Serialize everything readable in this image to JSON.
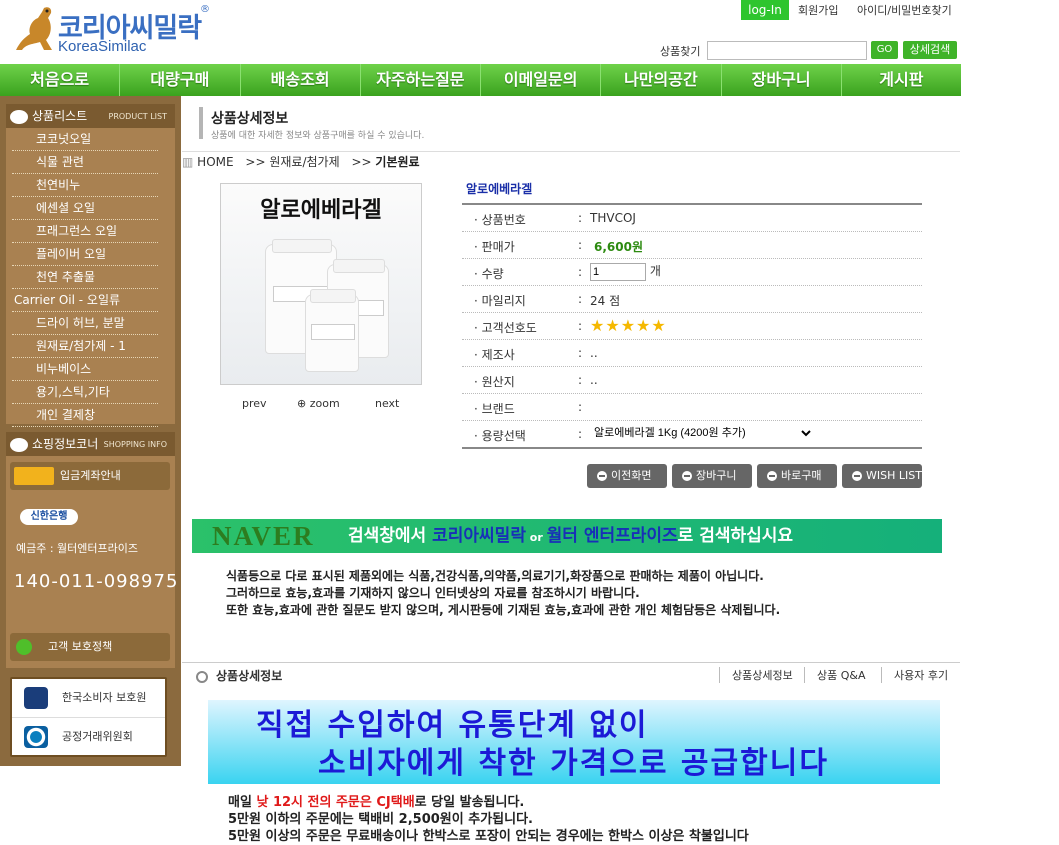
{
  "logo": {
    "ko": "코리아씨밀락",
    "en": "KoreaSimilac",
    "reg": "®"
  },
  "toplinks": {
    "login": "log-In",
    "join": "회원가입",
    "find": "아이디/비밀번호찾기"
  },
  "search": {
    "label": "상품찾기",
    "placeholder": "",
    "go": "GO",
    "advanced": "상세검색"
  },
  "nav": [
    "처음으로",
    "대량구매",
    "배송조회",
    "자주하는질문",
    "이메일문의",
    "나만의공간",
    "장바구니",
    "게시판"
  ],
  "sidebar": {
    "product_list_title": "상품리스트",
    "product_list_en": "PRODUCT LIST",
    "categories": [
      {
        "label": "코코넛오일",
        "type": "sub"
      },
      {
        "label": "식물 관련",
        "type": "sub"
      },
      {
        "label": "천연비누",
        "type": "sub"
      },
      {
        "label": "에센셜 오일",
        "type": "sub"
      },
      {
        "label": "프래그런스 오일",
        "type": "sub"
      },
      {
        "label": "플레이버 오일",
        "type": "sub"
      },
      {
        "label": "천연 추출물",
        "type": "sub"
      },
      {
        "label": "Carrier Oil - 오일류",
        "type": "main"
      },
      {
        "label": "드라이 허브, 분말",
        "type": "sub"
      },
      {
        "label": "원재료/첨가제 - 1",
        "type": "sub"
      },
      {
        "label": "비누베이스",
        "type": "sub"
      },
      {
        "label": "용기,스틱,기타",
        "type": "sub"
      },
      {
        "label": "개인 결제창",
        "type": "sub"
      }
    ],
    "shopping_title": "쇼핑정보코너",
    "shopping_en": "SHOPPING INFO",
    "deposit": "입금계좌안내",
    "bank": "신한은행",
    "holder": "예금주 : 월터엔터프라이즈",
    "account": "140-011-098975",
    "policy": "고객 보호정책",
    "links": [
      "한국소비자 보호원",
      "공정거래위원회"
    ]
  },
  "content": {
    "title": "상품상세정보",
    "subtitle": "상품에 대한 자세한 정보와 상품구매를 하실 수 있습니다.",
    "breadcrumb": {
      "home": "HOME",
      "sep": ">>",
      "cat": "원재료/첨가제",
      "current": "기본원료"
    }
  },
  "product": {
    "image_title": "알로에베라겔",
    "image_nav": {
      "prev": "prev",
      "zoom": "zoom",
      "next": "next"
    },
    "name": "알로에베라겔",
    "fields": [
      {
        "key": "상품번호",
        "value": "THVCOJ"
      },
      {
        "key": "판매가",
        "value": "6,600원"
      },
      {
        "key": "수량",
        "value": "1",
        "unit": "개"
      },
      {
        "key": "마일리지",
        "value": "24 점"
      },
      {
        "key": "고객선호도",
        "value": "★★★★★"
      },
      {
        "key": "제조사",
        "value": ".."
      },
      {
        "key": "원산지",
        "value": ".."
      },
      {
        "key": "브랜드",
        "value": ""
      },
      {
        "key": "용량선택",
        "value": "알로에베라겔 1Kg (4200원 추가)"
      }
    ],
    "rating": 5,
    "buttons": [
      "이전화면",
      "장바구니",
      "바로구매",
      "WISH LIST"
    ]
  },
  "banner": {
    "naver": "NAVER",
    "t1": "검색창에서 ",
    "hl1": "코리아씨밀락",
    "or": " or ",
    "hl2": "월터 엔터프라이즈",
    "t2": "로 검색하십시요"
  },
  "notice": [
    "식품등으로 다로 표시된 제품외에는 식품,건강식품,의약품,의료기기,화장품으로 판매하는 제품이 아닙니다.",
    "그러하므로 효능,효과를 기재하지 않으니 인터넷상의 자료를 참조하시기 바랍니다.",
    "또한 효능,효과에 관한 질문도 받지 않으며, 게시판등에 기재된 효능,효과에 관한 개인 체험담등은 삭제됩니다."
  ],
  "tabs": {
    "title": "상품상세정보",
    "links": [
      "상품상세정보",
      "상품 Q&A",
      "사용자 후기"
    ]
  },
  "promo": {
    "line1": "직접 수입하여 유통단계 없이",
    "line2": "소비자에게 착한 가격으로 공급합니다"
  },
  "shipping": {
    "l1a": "매일 ",
    "l1red": "낮 12시 전의 주문은 CJ택배",
    "l1b": "로 당일 발송됩니다.",
    "l2": "5만원 이하의 주문에는 택배비 2,500원이 추가됩니다.",
    "l3": "5만원 이상의 주문은 무료배송이나 한박스로 포장이 안되는 경우에는 한박스 이상은 착불입니다"
  }
}
